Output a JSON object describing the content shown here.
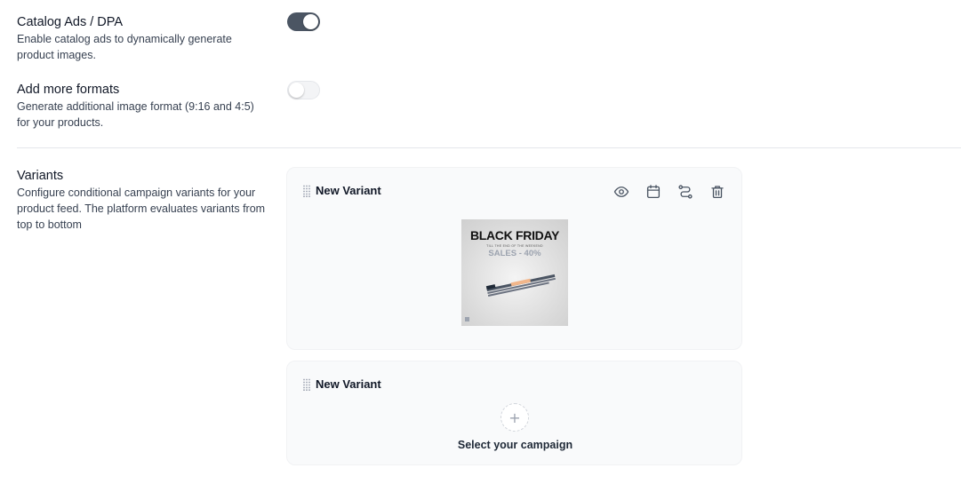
{
  "catalog_ads": {
    "title": "Catalog Ads / DPA",
    "description": "Enable catalog ads to dynamically generate product images.",
    "enabled": true
  },
  "more_formats": {
    "title": "Add more formats",
    "description": "Generate additional image format (9:16 and 4:5) for your products.",
    "enabled": false
  },
  "variants": {
    "title": "Variants",
    "description": "Configure conditional campaign variants for your product feed. The platform evaluates variants from top to bottom",
    "items": [
      {
        "name": "New Variant",
        "preview": {
          "headline": "BLACK FRIDAY",
          "subline": "TILL THE END OF THE WEEKEND",
          "sale": "SALES - 40%"
        }
      },
      {
        "name": "New Variant",
        "empty_label": "Select your campaign",
        "add_symbol": "+"
      }
    ]
  },
  "icons": [
    "drag-handle-icon",
    "eye-icon",
    "calendar-icon",
    "route-icon",
    "trash-icon",
    "plus-icon"
  ],
  "colors": {
    "toggle_on": "#4b5563",
    "card_bg": "#f9fafb",
    "divider": "#e5e7eb"
  }
}
